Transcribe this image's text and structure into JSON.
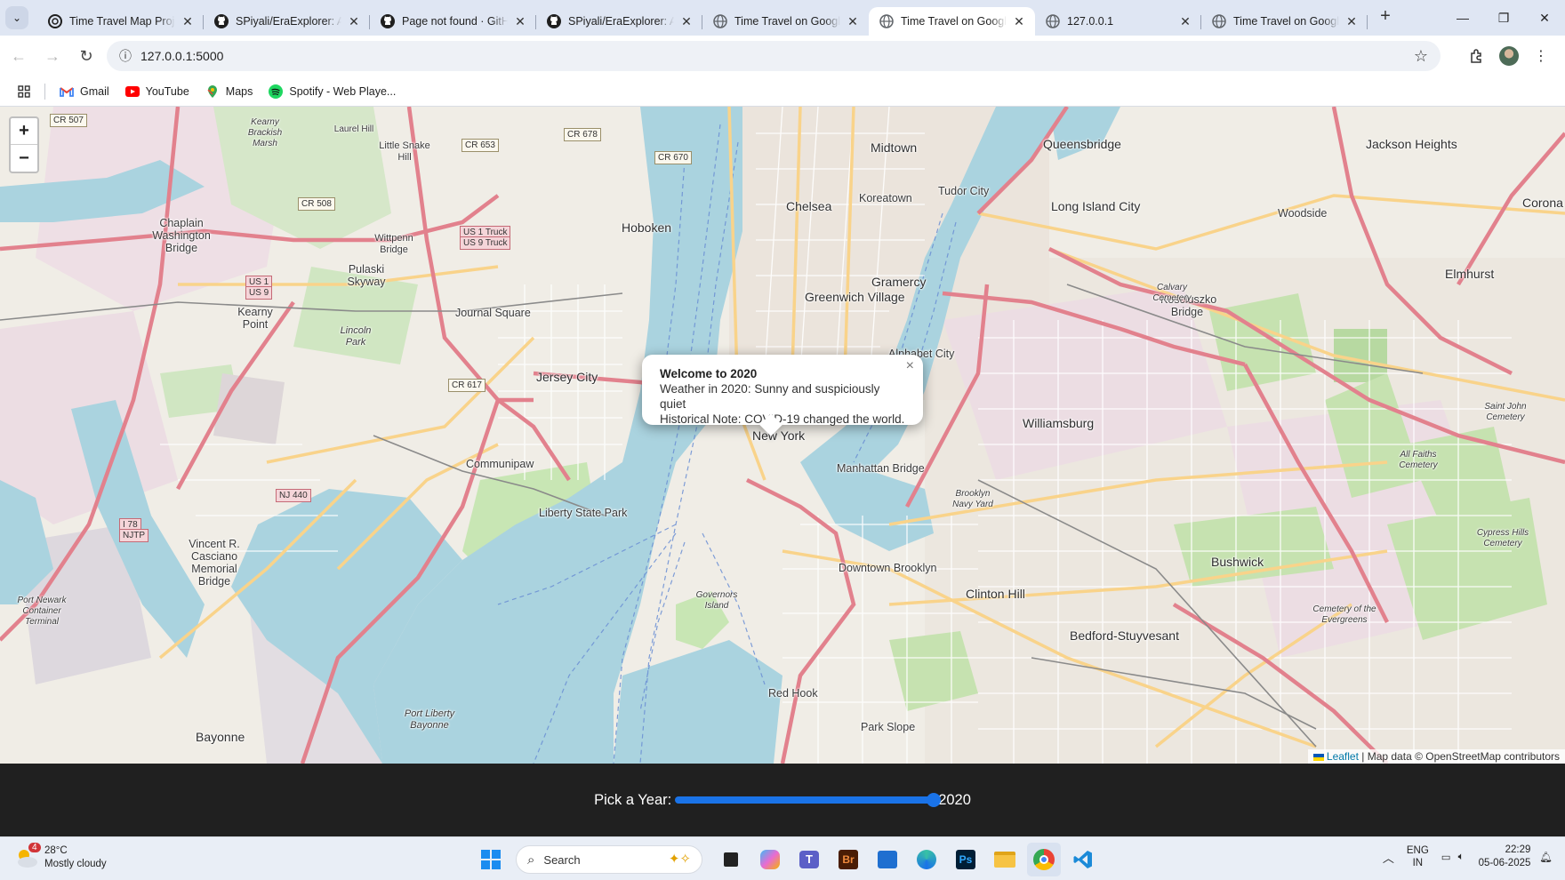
{
  "tabs": [
    {
      "title": "Time Travel Map Project",
      "icon": "chatgpt-icon",
      "active": false
    },
    {
      "title": "SPiyali/EraExplorer: A",
      "icon": "github-icon",
      "active": false
    },
    {
      "title": "Page not found · GitHub",
      "icon": "github-icon",
      "active": false
    },
    {
      "title": "SPiyali/EraExplorer: A",
      "icon": "github-icon",
      "active": false
    },
    {
      "title": "Time Travel on Google",
      "icon": "globe-icon",
      "active": false
    },
    {
      "title": "Time Travel on Google",
      "icon": "globe-icon",
      "active": true
    },
    {
      "title": "127.0.0.1",
      "icon": "globe-icon",
      "active": false
    },
    {
      "title": "Time Travel on Google",
      "icon": "globe-icon",
      "active": false
    }
  ],
  "address": {
    "url": "127.0.0.1:5000"
  },
  "bookmarks": [
    {
      "label": "Gmail",
      "icon": "gmail-icon"
    },
    {
      "label": "YouTube",
      "icon": "youtube-icon"
    },
    {
      "label": "Maps",
      "icon": "maps-icon"
    },
    {
      "label": "Spotify - Web Playe...",
      "icon": "spotify-icon"
    }
  ],
  "map": {
    "zoom_in": "+",
    "zoom_out": "−",
    "popup": {
      "title": "Welcome to 2020",
      "line1": "Weather in 2020: Sunny and suspiciously quiet",
      "line2": "Historical Note: COVID-19 changed the world.",
      "close": "×"
    },
    "attribution": {
      "leaflet": "Leaflet",
      "rest": " | Map data © OpenStreetMap contributors"
    },
    "places": [
      "Midtown",
      "Queensbridge",
      "Jackson Heights",
      "Koreatown",
      "Tudor City",
      "Chelsea",
      "Long Island City",
      "Woodside",
      "Corona",
      "Hoboken",
      "Gramercy",
      "Greenwich Village",
      "Elmhurst",
      "Jersey City",
      "Journal Square",
      "Alphabet City",
      "New York",
      "Williamsburg",
      "Manhattan Bridge",
      "Communipaw",
      "Liberty State Park",
      "Downtown Brooklyn",
      "Clinton Hill",
      "Bushwick",
      "Bedford-Stuyvesant",
      "Red Hook",
      "Park Slope",
      "Bayonne",
      "Vincent R. Casciano Memorial Bridge",
      "Kearny Point",
      "Pulaski Skyway",
      "Lincoln Park",
      "Chaplain Washington Bridge",
      "Wittpenn Bridge",
      "Kosciuszko Bridge",
      "Governors Island",
      "Brooklyn Navy Yard",
      "Port Liberty Bayonne",
      "Little Snake Hill",
      "Kearny Brackish Marsh",
      "Laurel Hill",
      "Port Newark Container Terminal",
      "Saint John Cemetery",
      "All Faiths Cemetery",
      "Cypress Hills Cemetery",
      "Cemetery of the Evergreens",
      "Calvary Cemetery"
    ],
    "shields": [
      "CR 507",
      "CR 678",
      "CR 653",
      "CR 670",
      "CR 508",
      "US 1 Truck",
      "US 9 Truck",
      "US 1",
      "US 9",
      "CR 617",
      "NJ 440",
      "I 78",
      "NJTP"
    ]
  },
  "year_picker": {
    "label": "Pick a Year:",
    "value": "2020",
    "progress": 1.0
  },
  "taskbar": {
    "weather_temp": "28°C",
    "weather_desc": "Mostly cloudy",
    "weather_badge": "4",
    "search_placeholder": "Search",
    "lang_top": "ENG",
    "lang_bottom": "IN",
    "time": "22:29",
    "date": "05-06-2025"
  },
  "colors": {
    "slider": "#1a73e8",
    "yearbar_bg": "#202020",
    "water": "#aad3df",
    "park": "#c8e6b4",
    "motorway": "#e8929d",
    "road": "#fcd6a4"
  }
}
